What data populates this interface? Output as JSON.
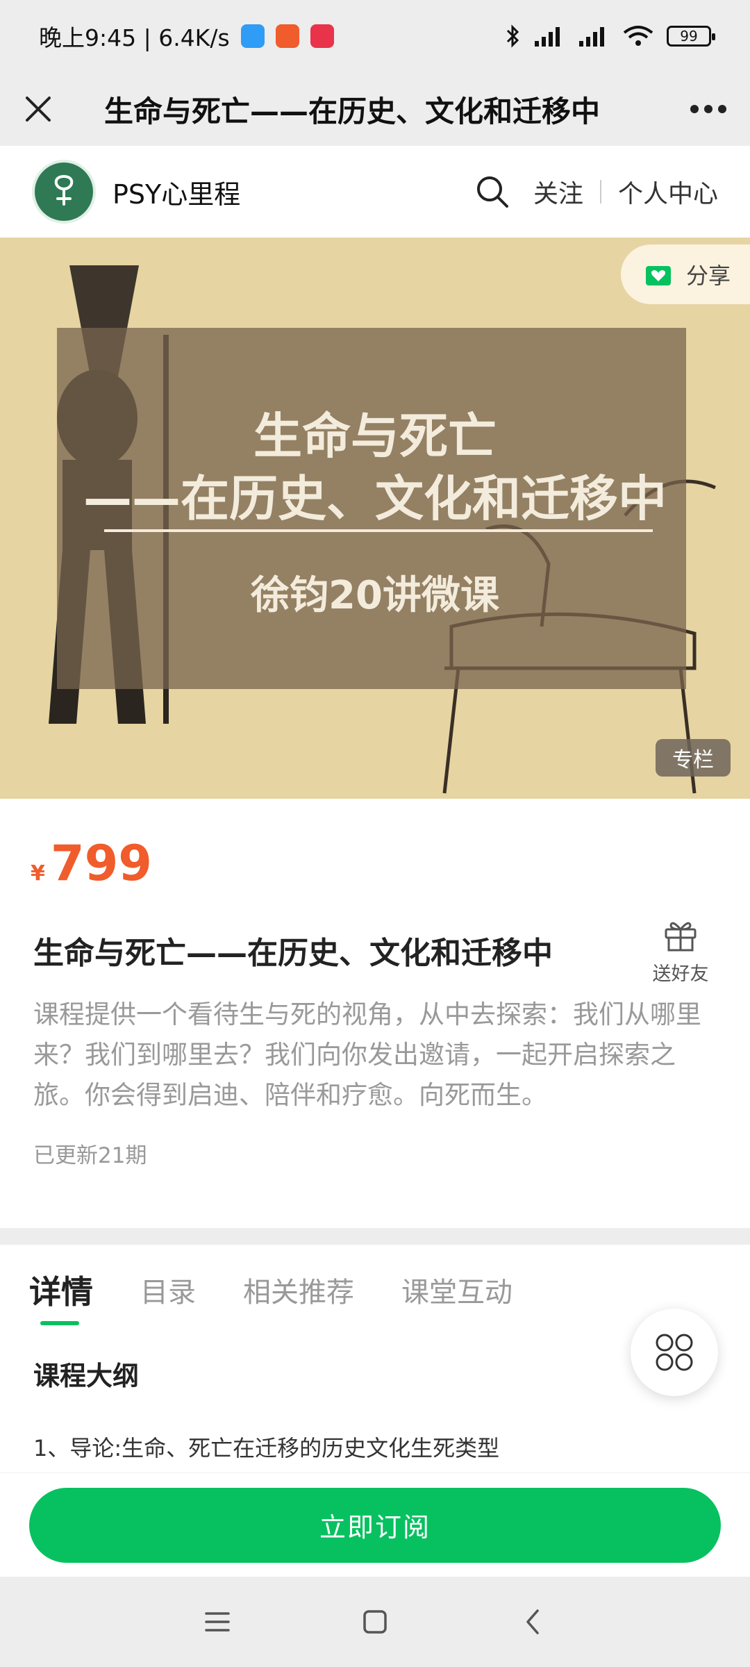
{
  "status_bar": {
    "time_speed": "晚上9:45 | 6.4K/s",
    "battery": "99"
  },
  "title_bar": {
    "title": "生命与死亡——在历史、文化和迁移中"
  },
  "account": {
    "name": "PSY心里程",
    "follow": "关注",
    "personal_center": "个人中心"
  },
  "cover": {
    "share_label": "分享",
    "title_line1": "生命与死亡",
    "title_line2": "——在历史、文化和迁移中",
    "subtitle": "徐钧20讲微课",
    "tag": "专栏"
  },
  "product": {
    "currency": "¥",
    "price": "799",
    "title": "生命与死亡——在历史、文化和迁移中",
    "gift_label": "送好友",
    "description": "课程提供一个看待生与死的视角，从中去探索：我们从哪里来？我们到哪里去？我们向你发出邀请，一起开启探索之旅。你会得到启迪、陪伴和疗愈。向死而生。",
    "updated": "已更新21期"
  },
  "tabs": [
    {
      "label": "详情",
      "active": true
    },
    {
      "label": "目录",
      "active": false
    },
    {
      "label": "相关推荐",
      "active": false
    },
    {
      "label": "课堂互动",
      "active": false
    }
  ],
  "content": {
    "outline_title": "课程大纲",
    "item1": "1、导论:生命、死亡在迁移的历史文化生死类型"
  },
  "subscribe": {
    "label": "立即订阅"
  },
  "colors": {
    "accent_green": "#07c160",
    "price_orange": "#f05c2c",
    "cover_bg": "#e6d4a2"
  }
}
